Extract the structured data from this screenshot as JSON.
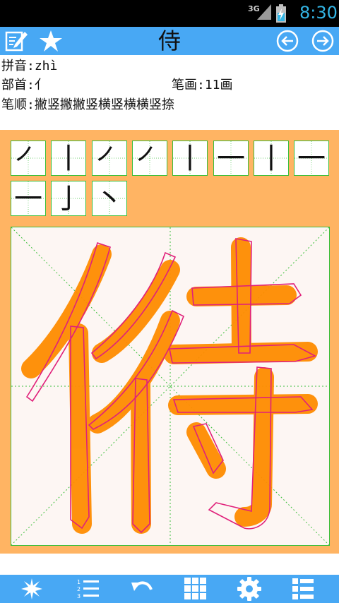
{
  "status_bar": {
    "network": "3G",
    "time": "8:30"
  },
  "toolbar": {
    "title": "侍",
    "icons": [
      "edit-icon",
      "star-icon",
      "prev-icon",
      "next-icon"
    ]
  },
  "info": {
    "pinyin_label": "拼音:",
    "pinyin": "zhì",
    "radical_label": "部首:",
    "radical": "亻",
    "strokes_label": "笔画:",
    "strokes": "11画",
    "order_label": "笔顺:",
    "order": "撇竖撇撇竖横竖横横竖捺"
  },
  "stroke_cells": [
    "㇒",
    "丨",
    "㇒",
    "㇒",
    "丨",
    "一",
    "丨",
    "一",
    "一",
    "亅",
    "丶"
  ],
  "bottom_bar": {
    "icons": [
      "burst-icon",
      "numbered-list-icon",
      "undo-icon",
      "grid-icon",
      "settings-icon",
      "list-icon"
    ]
  },
  "colors": {
    "accent": "#48a8f4",
    "panel": "#ffb463",
    "brush": "#ff8c00",
    "outline": "#e0207a",
    "grid": "#3cbf3c"
  }
}
